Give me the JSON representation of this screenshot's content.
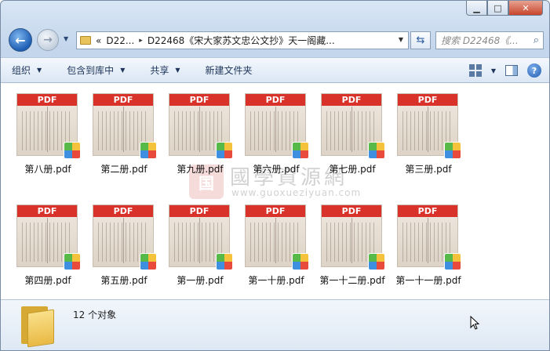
{
  "window": {
    "caption": {
      "minimize": "▁",
      "maximize": "□",
      "close": "✕"
    }
  },
  "nav": {
    "back_icon": "back-arrow-icon",
    "forward_icon": "forward-arrow-icon",
    "breadcrumb": {
      "overflow": "«",
      "parent": "D22...",
      "separator": "▸",
      "current": "D22468《宋大家苏文忠公文抄》天一阁藏..."
    },
    "search_placeholder": "搜索 D22468《...",
    "search_icon": "search-icon",
    "refresh_icon": "refresh-icon"
  },
  "toolbar": {
    "organize": "组织",
    "include_in_library": "包含到库中",
    "share": "共享",
    "new_folder": "新建文件夹"
  },
  "files": [
    {
      "name": "第八册.pdf",
      "banner": "PDF"
    },
    {
      "name": "第二册.pdf",
      "banner": "PDF"
    },
    {
      "name": "第九册.pdf",
      "banner": "PDF"
    },
    {
      "name": "第六册.pdf",
      "banner": "PDF"
    },
    {
      "name": "第七册.pdf",
      "banner": "PDF"
    },
    {
      "name": "第三册.pdf",
      "banner": "PDF"
    },
    {
      "name": "第四册.pdf",
      "banner": "PDF"
    },
    {
      "name": "第五册.pdf",
      "banner": "PDF"
    },
    {
      "name": "第一册.pdf",
      "banner": "PDF"
    },
    {
      "name": "第一十册.pdf",
      "banner": "PDF"
    },
    {
      "name": "第一十二册.pdf",
      "banner": "PDF"
    },
    {
      "name": "第一十一册.pdf",
      "banner": "PDF"
    }
  ],
  "watermark": {
    "seal": "国",
    "title": "國學資源網",
    "url": "www.guoxueziyuan.com"
  },
  "status": {
    "item_count": "12 个对象"
  },
  "colors": {
    "pdf_banner": "#d9322b",
    "window_frame": "#c3d6ec",
    "close_button": "#c8452c"
  }
}
